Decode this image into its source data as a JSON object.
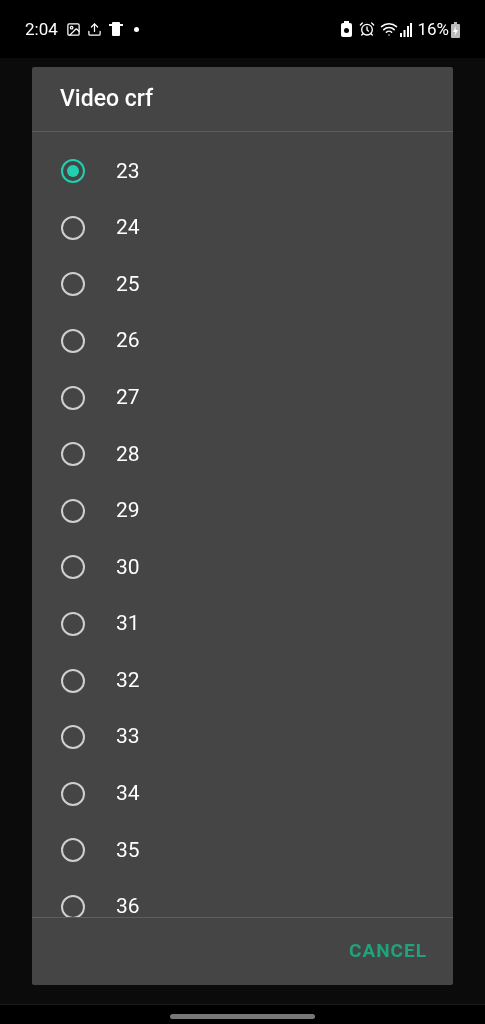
{
  "status_bar": {
    "time": "2:04",
    "battery": "16%"
  },
  "dialog": {
    "title": "Video crf",
    "options": [
      {
        "label": "23",
        "selected": true
      },
      {
        "label": "24",
        "selected": false
      },
      {
        "label": "25",
        "selected": false
      },
      {
        "label": "26",
        "selected": false
      },
      {
        "label": "27",
        "selected": false
      },
      {
        "label": "28",
        "selected": false
      },
      {
        "label": "29",
        "selected": false
      },
      {
        "label": "30",
        "selected": false
      },
      {
        "label": "31",
        "selected": false
      },
      {
        "label": "32",
        "selected": false
      },
      {
        "label": "33",
        "selected": false
      },
      {
        "label": "34",
        "selected": false
      },
      {
        "label": "35",
        "selected": false
      },
      {
        "label": "36",
        "selected": false
      }
    ],
    "buttons": [
      "CANCEL"
    ]
  }
}
